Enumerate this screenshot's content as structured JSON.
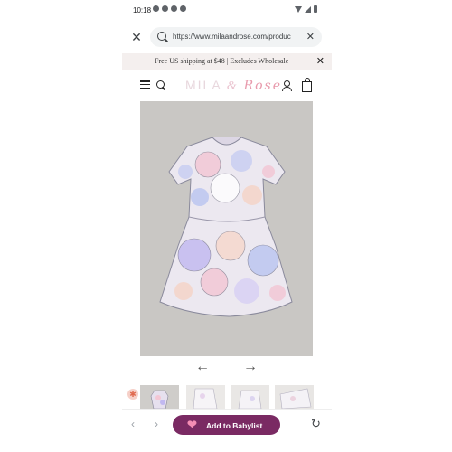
{
  "status_bar": {
    "time": "10:18"
  },
  "url_bar": {
    "url": "https://www.milaandrose.com/produc"
  },
  "promo": {
    "text": "Free US shipping at $48 | Excludes Wholesale"
  },
  "header": {
    "logo_mila": "MILA",
    "logo_amp": "&",
    "logo_rose": "Rose"
  },
  "bottom_bar": {
    "babylist_label": "Add to Babylist"
  },
  "colors": {
    "babylist_button": "#7a2a63",
    "promo_background": "#f4efee",
    "product_background": "#c9c7c4"
  }
}
